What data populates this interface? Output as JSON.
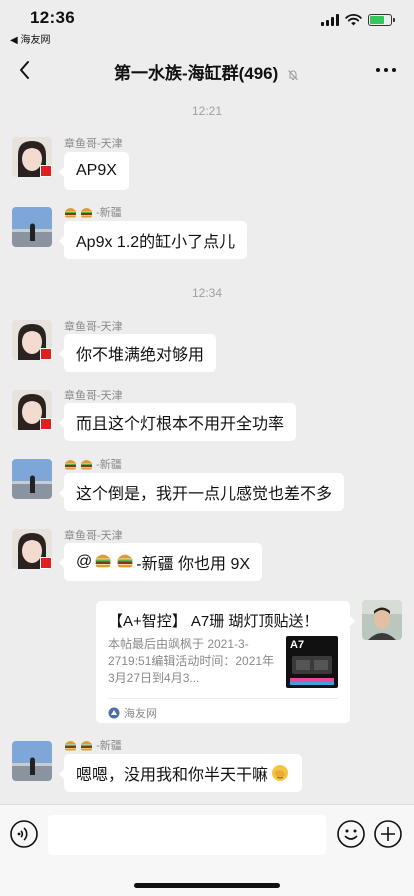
{
  "status": {
    "time": "12:36",
    "back_app": "◀ 海友网"
  },
  "nav": {
    "title": "第一水族-海缸群(496)"
  },
  "chat": {
    "times": [
      "12:21",
      "12:34"
    ],
    "messages": [
      {
        "sender": "章鱼哥-天津",
        "text": "AP9X"
      },
      {
        "sender": "-新疆",
        "text": "Ap9x 1.2的缸小了点儿"
      },
      {
        "sender": "章鱼哥-天津",
        "text": "你不堆满绝对够用"
      },
      {
        "sender": "章鱼哥-天津",
        "text": "而且这个灯根本不用开全功率"
      },
      {
        "sender": "-新疆",
        "text": "这个倒是，我开一点儿感觉也差不多"
      },
      {
        "sender": "章鱼哥-天津",
        "text_prefix": "@",
        "text_suffix": "-新疆 你也用 9X"
      },
      {
        "sender": "-新疆",
        "text": "嗯嗯，没用我和你半天干嘛"
      }
    ],
    "card": {
      "title": "【A+智控】 A7珊 瑚灯顶贴送！",
      "desc": "本帖最后由飒枫于 2021-3-2719:51编辑活动时间：2021年3月27日到4月3...",
      "thumb_label": "A7",
      "source": "海友网"
    }
  },
  "colors": {
    "background": "#ededed",
    "bubble": "#ffffff",
    "meta_text": "#8a8a8a"
  }
}
